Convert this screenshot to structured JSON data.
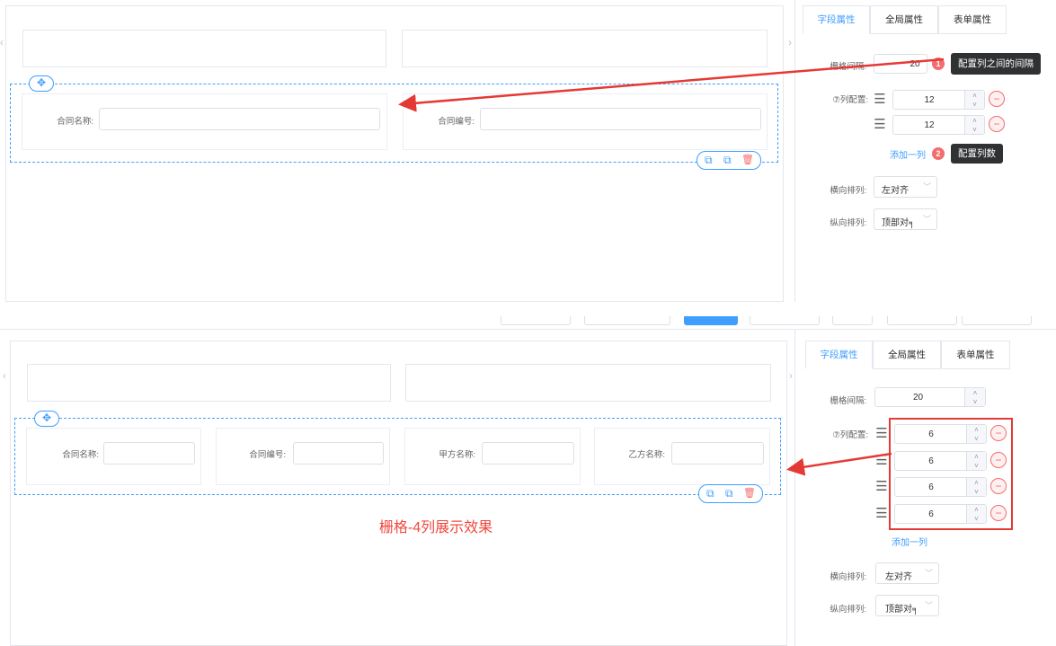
{
  "colors": {
    "accent": "#409eff",
    "danger": "#f56c6c",
    "annotation": "#e53935",
    "tooltip": "#303133"
  },
  "icons": {
    "move": "✥",
    "copy": "⧉",
    "delete": "🗑",
    "drag": "☰",
    "minus": "−",
    "up": "˄",
    "down": "˅",
    "chevron_down": "﹀",
    "collapse_left": "‹",
    "collapse_right": "›"
  },
  "panel_tabs": [
    "字段属性",
    "全局属性",
    "表单属性"
  ],
  "top": {
    "form_fields": [
      {
        "label": "合同名称:"
      },
      {
        "label": "合同编号:"
      }
    ],
    "props": {
      "gutter_label": "栅格间隔:",
      "gutter_value": "20",
      "columns_label": "⑦列配置:",
      "columns": [
        "12",
        "12"
      ],
      "add_column": "添加一列",
      "justify_label": "横向排列:",
      "justify_value": "左对齐",
      "align_label": "纵向排列:",
      "align_value": "顶部对╕"
    },
    "callouts": [
      {
        "badge": "1",
        "text": "配置列之间的间隔"
      },
      {
        "badge": "2",
        "text": "配置列数"
      }
    ]
  },
  "bottom": {
    "form_fields": [
      {
        "label": "合同名称:"
      },
      {
        "label": "合同编号:"
      },
      {
        "label": "甲方名称:"
      },
      {
        "label": "乙方名称:"
      }
    ],
    "props": {
      "gutter_label": "栅格间隔:",
      "gutter_value": "20",
      "columns_label": "⑦列配置:",
      "columns": [
        "6",
        "6",
        "6",
        "6"
      ],
      "add_column": "添加一列",
      "justify_label": "横向排列:",
      "justify_value": "左对齐",
      "align_label": "纵向排列:",
      "align_value": "顶部对╕"
    },
    "caption": "栅格-4列展示效果"
  }
}
